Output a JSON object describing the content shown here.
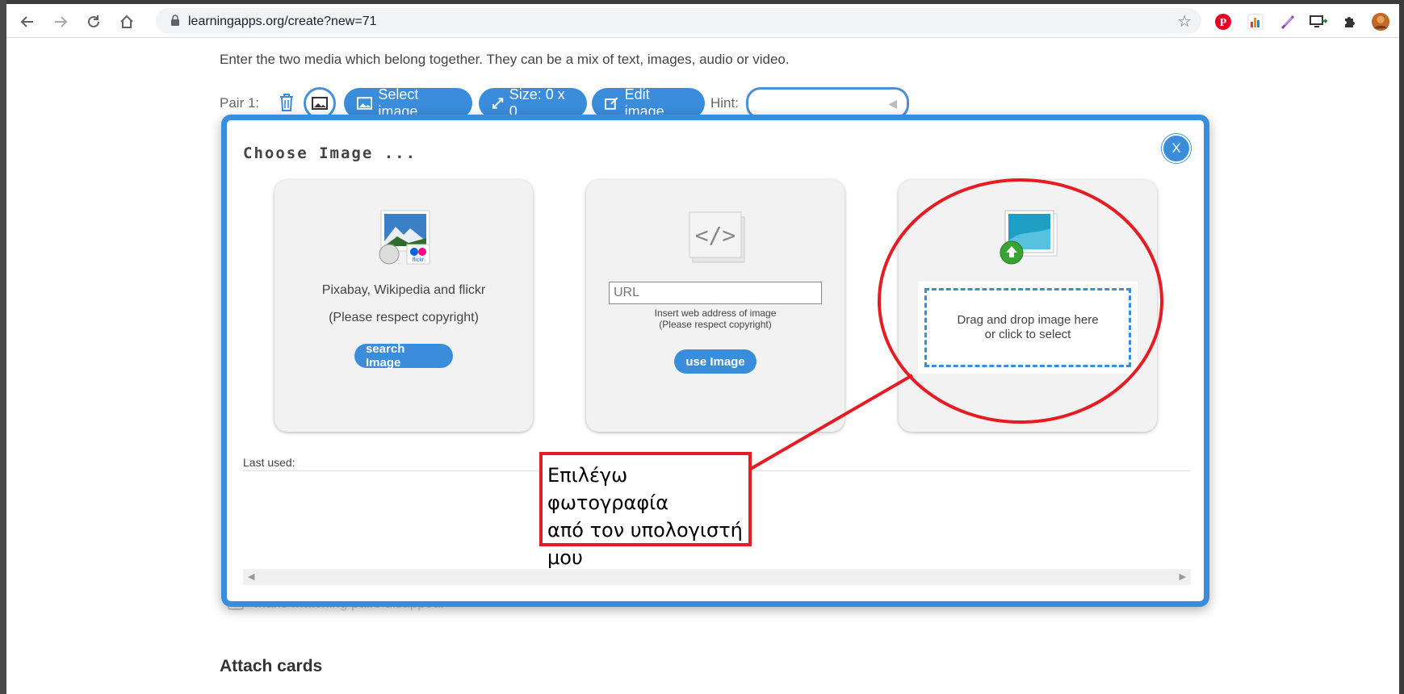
{
  "browser": {
    "url": "learningapps.org/create?new=71"
  },
  "page": {
    "intro": "Enter the two media which belong together. They can be a mix of text, images, audio or video.",
    "pair_label": "Pair 1:",
    "select_image": "Select image",
    "size": "Size: 0 x 0",
    "edit_image": "Edit image",
    "hint_label": "Hint:",
    "hint_value": "",
    "faded_option": "Make matching pairs disappear",
    "attach_heading": "Attach cards"
  },
  "modal": {
    "title": "Choose Image ...",
    "close": "X",
    "cards": [
      {
        "line1": "Pixabay, Wikipedia and flickr",
        "line2": "(Please respect copyright)",
        "button": "search Image"
      },
      {
        "url_placeholder": "URL",
        "note1": "Insert web address of image",
        "note2": "(Please respect copyright)",
        "button": "use Image"
      },
      {
        "drop1": "Drag and drop image here",
        "drop2": "or click to select"
      }
    ],
    "last_used": "Last used:"
  },
  "annotation": {
    "line1": "Επιλέγω φωτογραφία",
    "line2": "από τον υπολογιστή",
    "line3": "μου",
    "color": "#e51c23"
  },
  "colors": {
    "accent": "#3a8ddb",
    "annotation": "#e51c23"
  }
}
